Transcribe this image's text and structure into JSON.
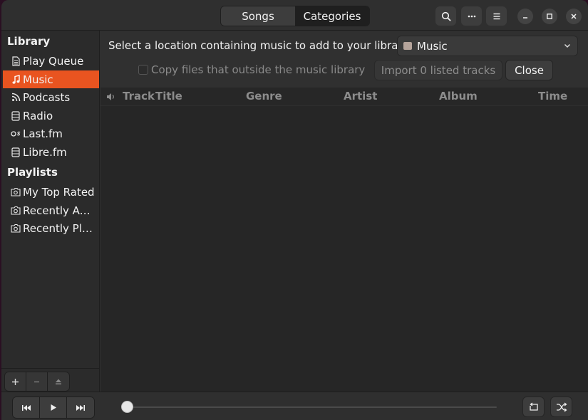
{
  "header": {
    "tabs": [
      {
        "label": "Songs",
        "active": false
      },
      {
        "label": "Categories",
        "active": true
      }
    ],
    "buttons": [
      "search-icon",
      "more-icon",
      "menu-icon"
    ],
    "window_controls": [
      "minimize-icon",
      "maximize-icon",
      "close-icon"
    ]
  },
  "sidebar": {
    "library_title": "Library",
    "library_items": [
      {
        "label": "Play Queue",
        "icon": "document-icon"
      },
      {
        "label": "Music",
        "icon": "music-note-icon",
        "active": true
      },
      {
        "label": "Podcasts",
        "icon": "rss-icon"
      },
      {
        "label": "Radio",
        "icon": "radio-icon"
      },
      {
        "label": "Last.fm",
        "icon": "lastfm-icon"
      },
      {
        "label": "Libre.fm",
        "icon": "radio-icon"
      }
    ],
    "playlists_title": "Playlists",
    "playlist_items": [
      {
        "label": "My Top Rated",
        "icon": "playlist-icon"
      },
      {
        "label": "Recently Added",
        "icon": "playlist-icon"
      },
      {
        "label": "Recently Played",
        "icon": "playlist-icon"
      }
    ],
    "tools": [
      "add-icon",
      "remove-icon",
      "eject-icon"
    ]
  },
  "import": {
    "label": "Select a location containing music to add to your library:",
    "location": "Music",
    "copy_files_label": "Copy files that outside the music library",
    "copy_files_checked": false,
    "import_button": "Import 0 listed tracks",
    "close_button": "Close"
  },
  "tracklist": {
    "columns": [
      "Track",
      "Title",
      "Genre",
      "Artist",
      "Album",
      "Time"
    ],
    "rows": []
  },
  "player": {
    "progress": 0,
    "transport": [
      "previous-icon",
      "play-icon",
      "next-icon"
    ],
    "right_buttons": [
      "repeat-icon",
      "shuffle-icon"
    ]
  },
  "colors": {
    "accent": "#e95420",
    "window_bg": "#303030",
    "list_bg": "#262626"
  }
}
